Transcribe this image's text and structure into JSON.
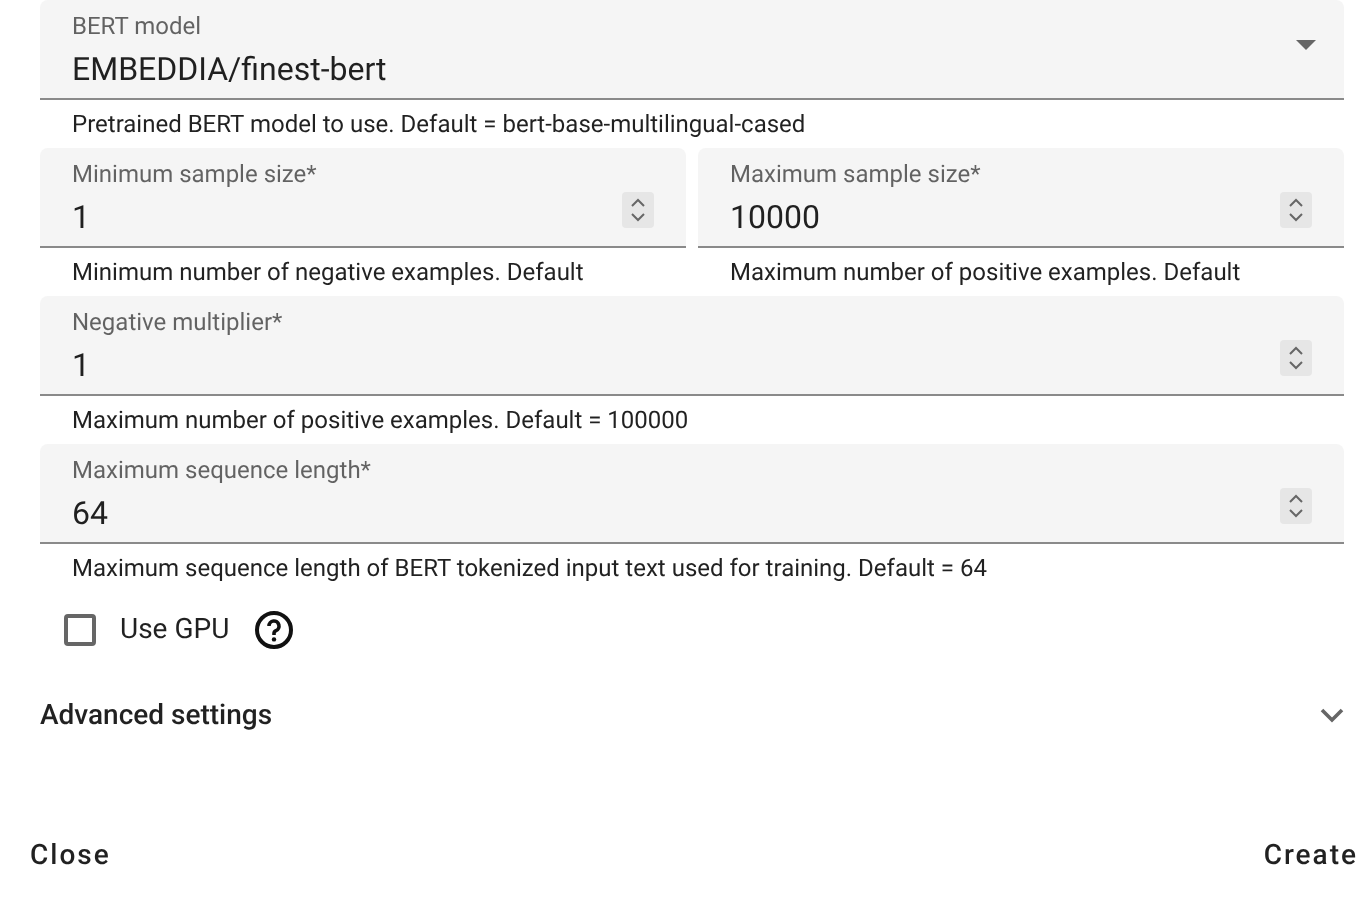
{
  "rows": [
    [
      {
        "kind": "select",
        "label": "BERT model",
        "value": "EMBEDDIA/finest-bert",
        "hint": "Pretrained BERT model to use. Default = bert-base-multilingual-cased"
      }
    ],
    [
      {
        "kind": "number",
        "label": "Minimum sample size*",
        "value": "1",
        "hint": "Minimum number of negative examples. Default"
      },
      {
        "kind": "number",
        "label": "Maximum sample size*",
        "value": "10000",
        "hint": "Maximum number of positive examples. Default"
      }
    ],
    [
      {
        "kind": "number",
        "label": "Negative multiplier*",
        "value": "1",
        "hint": "Maximum number of positive examples. Default = 100000"
      }
    ],
    [
      {
        "kind": "number",
        "label": "Maximum sequence length*",
        "value": "64",
        "hint": "Maximum sequence length of BERT tokenized input text used for training. Default = 64"
      }
    ]
  ],
  "gpu": {
    "label": "Use GPU",
    "checked": false
  },
  "advanced": {
    "title": "Advanced settings",
    "expanded": false
  },
  "buttons": [
    "Close",
    "Create"
  ]
}
